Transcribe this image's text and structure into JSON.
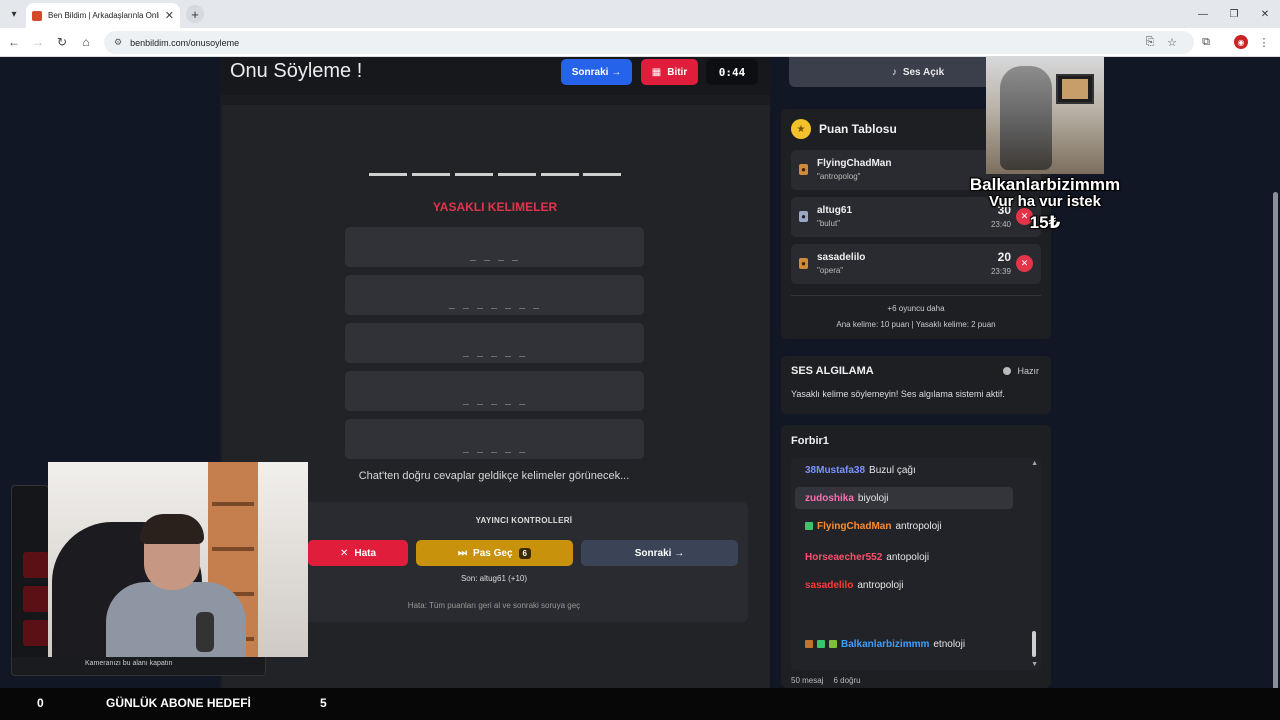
{
  "browser": {
    "tab_title": "Ben Bildim | Arkadaşlarınla Onli",
    "url": "benbildim.com/onusoyleme"
  },
  "game": {
    "title": "Onu Söyleme !",
    "next_label": "Sonraki →",
    "finish_label": "Bitir",
    "timer": "0:44",
    "forbidden_title": "YASAKLI KELIMELER",
    "forbidden_words": [
      "_ _ _ _",
      "_ _ _ _ _ _ _",
      "_ _ _ _ _",
      "_ _ _ _ _",
      "_ _ _ _ _"
    ],
    "hint": "Chat'ten doğru cevaplar geldikçe kelimeler görünecek...",
    "controls": {
      "title": "YAYINCI KONTROLLERİ",
      "error_label": "Hata",
      "pass_label": "Pas Geç",
      "pass_count": "6",
      "next_label": "Sonraki →",
      "last": "Son: altug61 (+10)",
      "note": "Hata: Tüm puanları geri al ve sonraki soruya geç"
    }
  },
  "sound_button": "Ses Açık",
  "scoreboard": {
    "title": "Puan Tablosu",
    "players": [
      {
        "name": "FlyingChadMan",
        "word": "\"antropolog\"",
        "score": "",
        "time": ""
      },
      {
        "name": "altug61",
        "word": "\"bulut\"",
        "score": "30",
        "time": "23:40"
      },
      {
        "name": "sasadelilo",
        "word": "\"opera\"",
        "score": "20",
        "time": "23:39"
      }
    ],
    "more": "+6 oyuncu daha",
    "rules": "Ana kelime: 10 puan | Yasaklı kelime: 2 puan"
  },
  "voice": {
    "title": "SES ALGILAMA",
    "status": "Hazır",
    "text": "Yasaklı kelime söylemeyin! Ses algılama sistemi aktif."
  },
  "chat": {
    "title": "Forbir1",
    "messages": [
      {
        "user": "38Mustafa38",
        "text": "Buzul çağı",
        "color": "#7b93ff"
      },
      {
        "user": "zudoshika",
        "text": "biyoloji",
        "color": "#ff6db0"
      },
      {
        "user": "FlyingChadMan",
        "text": "antropoloji",
        "color": "#ff8c2e"
      },
      {
        "user": "Horseaecher552",
        "text": "antopoloji",
        "color": "#ff4f6e"
      },
      {
        "user": "sasadelilo",
        "text": "antropoloji",
        "color": "#ff3a3a"
      },
      {
        "user": "Balkanlarbizimmm",
        "text": "etnoloji",
        "color": "#3da0ff"
      }
    ],
    "count": "50 mesaj",
    "correct": "6 doğru"
  },
  "overlay": {
    "line1": "Balkanlarbizimmm",
    "line2": "Vur ha vur istek",
    "line3": "15₺",
    "cam_caption": "Kameranızı bu alanı kapatın"
  },
  "goal_bar": {
    "current": "0",
    "label": "GÜNLÜK ABONE HEDEFİ",
    "target": "5"
  },
  "colors": {
    "accent_blue": "#2563eb",
    "accent_red": "#e11d3c",
    "gold": "#c9920c"
  }
}
